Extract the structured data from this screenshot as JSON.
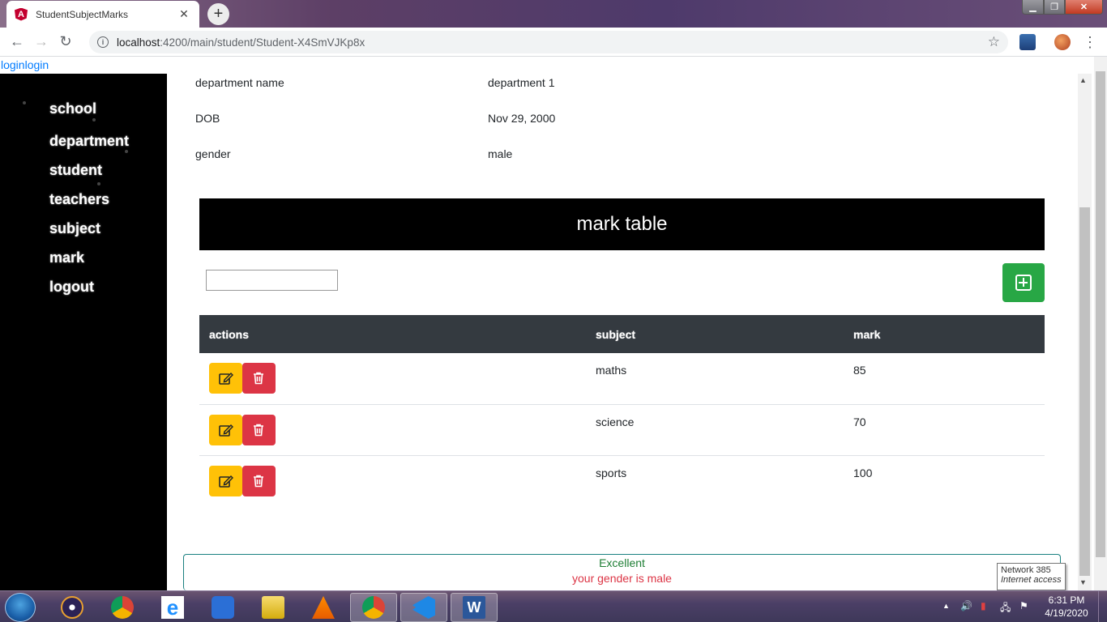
{
  "browser": {
    "tab_title": "StudentSubjectMarks",
    "tab_close": "✕",
    "new_tab": "+",
    "url_host": "localhost",
    "url_rest": ":4200/main/student/Student-X4SmVJKp8x",
    "back": "←",
    "forward": "→",
    "reload": "↻",
    "star": "☆",
    "menu": "⋮",
    "win_min": "▁",
    "win_max": "❐",
    "win_close": "✕"
  },
  "login_link": "loginlogin",
  "sidebar": {
    "items": [
      {
        "label": "school"
      },
      {
        "label": "department"
      },
      {
        "label": "student"
      },
      {
        "label": "teachers"
      },
      {
        "label": "subject"
      },
      {
        "label": "mark"
      },
      {
        "label": "logout"
      }
    ]
  },
  "details": [
    {
      "label": "department name",
      "value": "department 1"
    },
    {
      "label": "DOB",
      "value": "Nov 29, 2000"
    },
    {
      "label": "gender",
      "value": "male"
    }
  ],
  "mark_table": {
    "title": "mark table",
    "search_value": "",
    "columns": [
      "actions",
      "subject",
      "mark"
    ],
    "rows": [
      {
        "subject": "maths",
        "mark": "85"
      },
      {
        "subject": "science",
        "mark": "70"
      },
      {
        "subject": "sports",
        "mark": "100"
      }
    ]
  },
  "alert": {
    "line1": "Excellent",
    "line2": "your gender is male"
  },
  "tooltip": {
    "line1": "Network  385",
    "line2": "Internet access"
  },
  "taskbar": {
    "time": "6:31 PM",
    "date": "4/19/2020"
  },
  "colors": {
    "primary_link": "#007bff",
    "success": "#28a745",
    "warning": "#ffc107",
    "danger": "#dc3545",
    "table_head": "#343a40"
  }
}
